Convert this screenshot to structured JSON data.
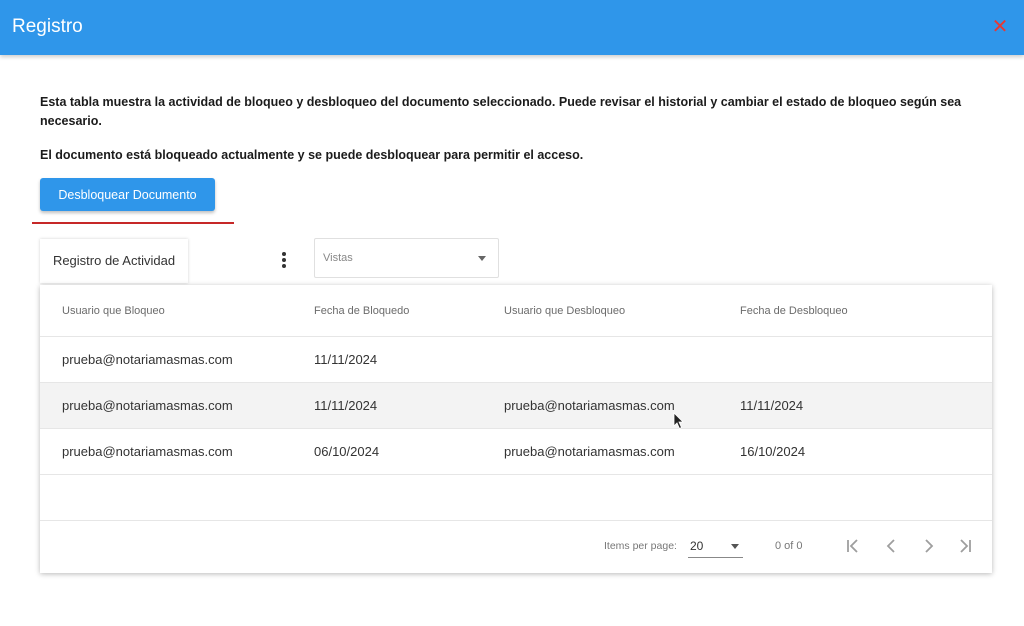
{
  "dialog": {
    "title": "Registro",
    "close_icon": "close-icon"
  },
  "description": "Esta tabla muestra la actividad de bloqueo y desbloqueo del documento seleccionado. Puede revisar el historial y cambiar el estado de bloqueo según sea necesario.",
  "status_message": "El documento está bloqueado actualmente y se puede desbloquear para permitir el acceso.",
  "unlock_button_label": "Desbloquear Documento",
  "tab_label": "Registro de Actividad",
  "views_placeholder": "Vistas",
  "table": {
    "headers": [
      "Usuario que Bloqueo",
      "Fecha de Bloquedo",
      "Usuario que Desbloqueo",
      "Fecha de Desbloqueo"
    ],
    "rows": [
      [
        "prueba@notariamasmas.com",
        "11/11/2024",
        "",
        ""
      ],
      [
        "prueba@notariamasmas.com",
        "11/11/2024",
        "prueba@notariamasmas.com",
        "11/11/2024"
      ],
      [
        "prueba@notariamasmas.com",
        "06/10/2024",
        "prueba@notariamasmas.com",
        "16/10/2024"
      ]
    ]
  },
  "paginator": {
    "items_per_page_label": "Items per page:",
    "items_per_page_value": "20",
    "range_label": "0 of 0"
  },
  "colors": {
    "header_bg": "#2f96ea",
    "button_bg": "#2f96ea",
    "close_icon": "#e53935",
    "underline": "#c62828"
  }
}
